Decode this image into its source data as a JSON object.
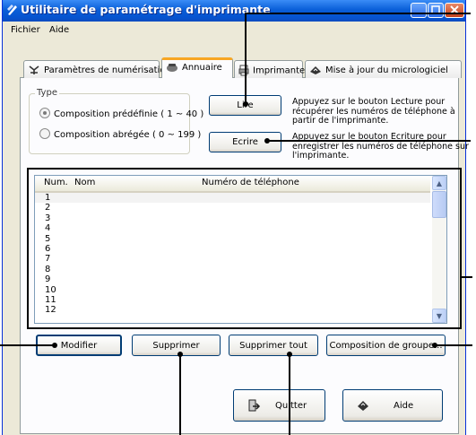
{
  "window": {
    "title": "Utilitaire de paramétrage d'imprimante"
  },
  "menu": [
    "Fichier",
    "Aide"
  ],
  "tabs": [
    {
      "label": "Paramètres de numérisation",
      "icon": "scanner-icon",
      "active": false
    },
    {
      "label": "Annuaire",
      "icon": "phonebook-icon",
      "active": true
    },
    {
      "label": "Imprimante",
      "icon": "printer-icon",
      "active": false
    },
    {
      "label": "Mise à jour du micrologiciel",
      "icon": "firmware-icon",
      "active": false
    }
  ],
  "type_group": {
    "legend": "Type",
    "options": [
      {
        "label": "Composition prédéfinie ( 1 ~ 40 )",
        "selected": true
      },
      {
        "label": "Composition abrégée ( 0 ~ 199 )",
        "selected": false
      }
    ]
  },
  "actions": {
    "read_label": "Lire",
    "read_desc": [
      "Appuyez sur le bouton Lecture pour",
      "récupérer les numéros de téléphone à",
      "partir de l'imprimante."
    ],
    "write_label": "Ecrire",
    "write_desc": [
      "Appuyez sur le bouton Ecriture pour",
      "enregistrer les numéros de téléphone sur",
      "l'imprimante."
    ]
  },
  "list": {
    "columns": [
      "Num.",
      "Nom",
      "Numéro de téléphone"
    ],
    "rows": [
      "1",
      "2",
      "3",
      "4",
      "5",
      "6",
      "7",
      "8",
      "9",
      "10",
      "11",
      "12"
    ]
  },
  "row_buttons": {
    "modify": "Modifier",
    "delete": "Supprimer",
    "delete_all": "Supprimer tout",
    "group_dial": "Composition de groupe..."
  },
  "footer": {
    "quit": "Quitter",
    "help": "Aide"
  },
  "colors": {
    "titlebar": "#0a5fd8",
    "dialog_bg": "#ece9d8",
    "active_tab_accent": "#f7a623"
  }
}
